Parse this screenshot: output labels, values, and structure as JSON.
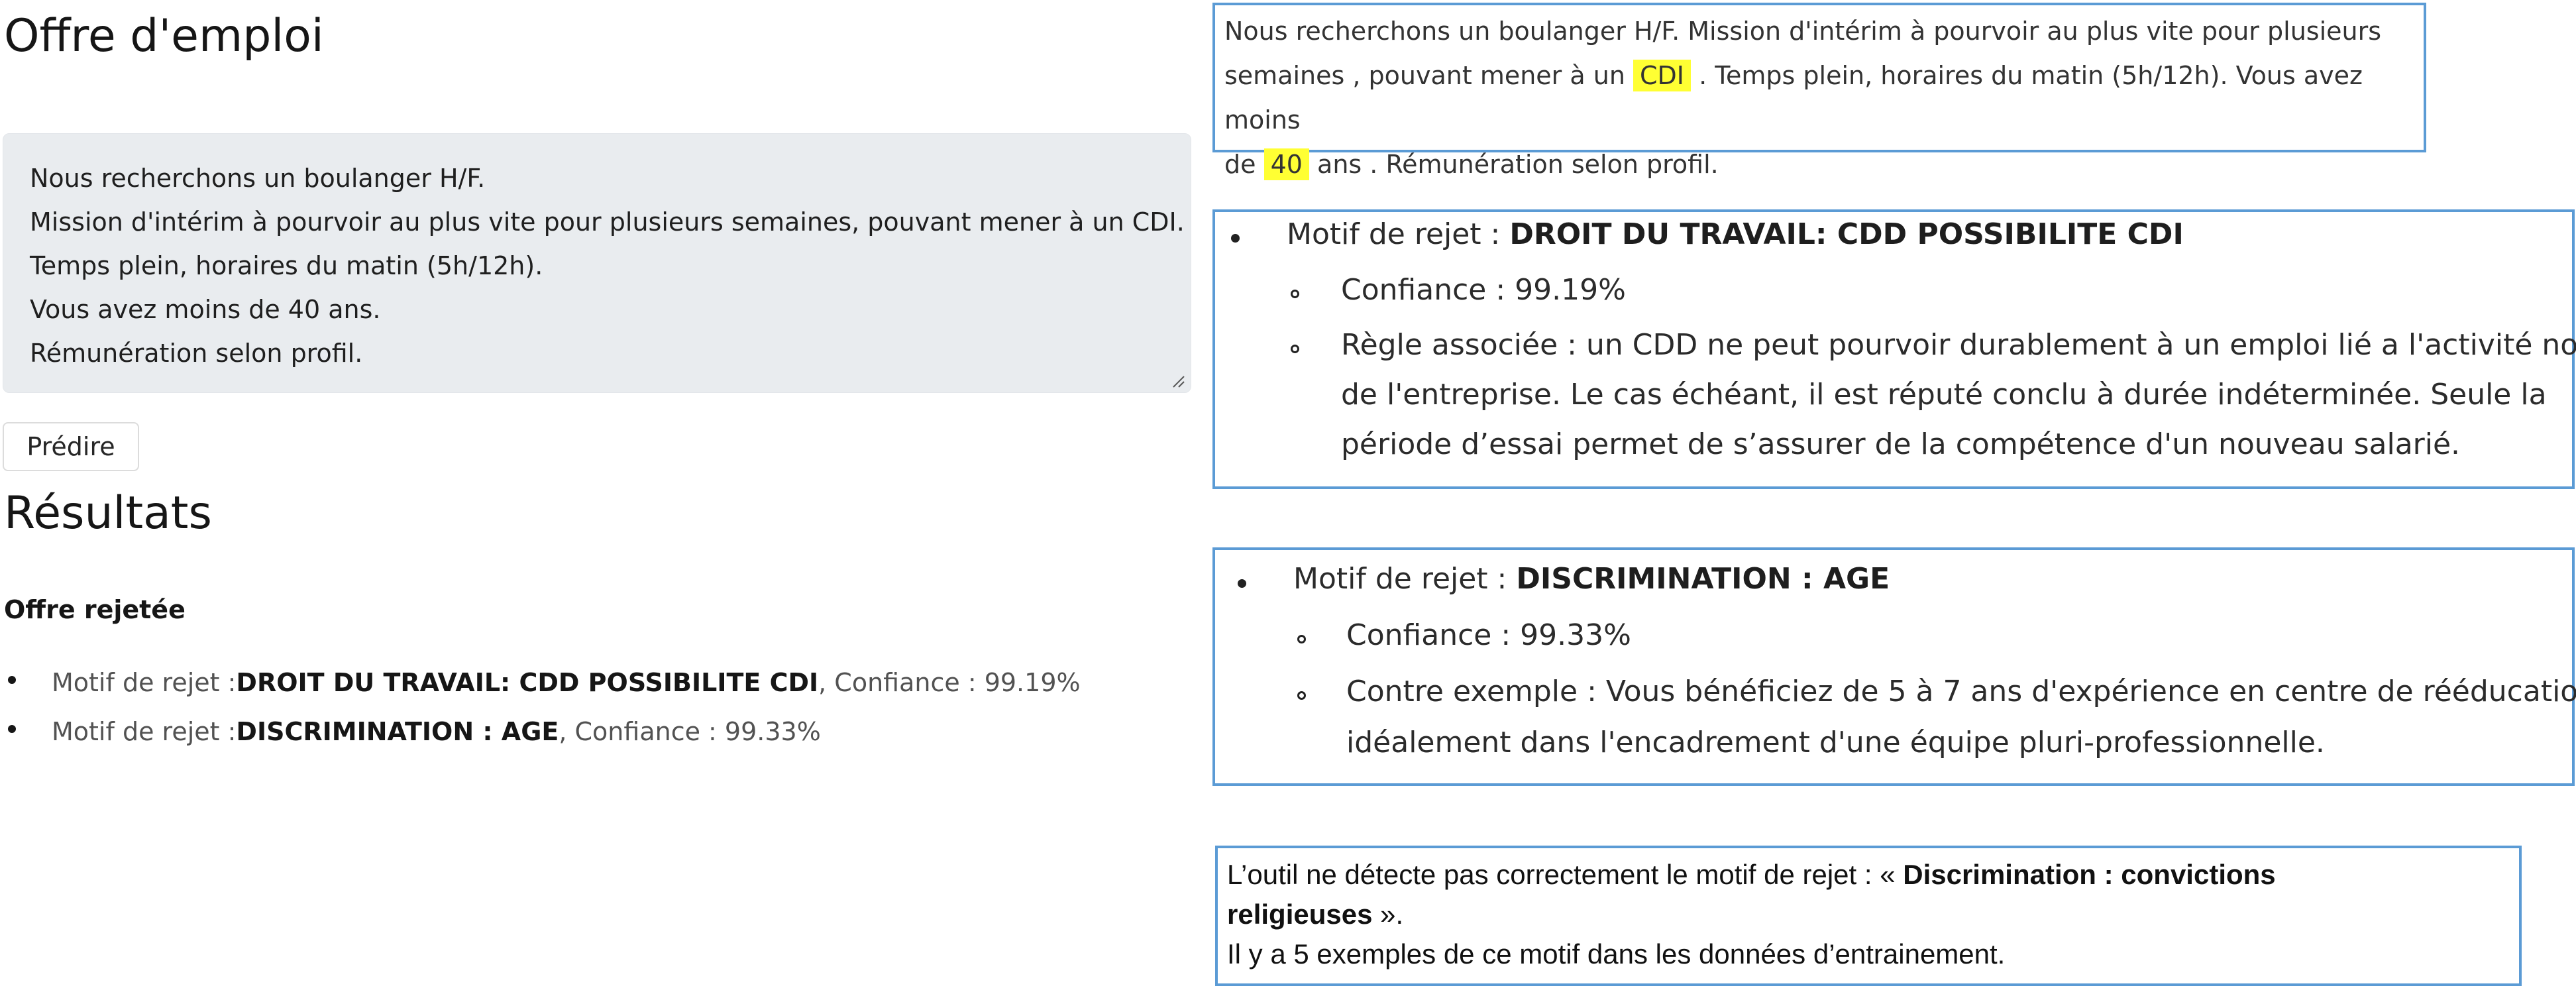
{
  "app": {
    "page_title": "Offre d'emploi",
    "textarea_lines": [
      "Nous recherchons un boulanger H/F.",
      "Mission d'intérim à pourvoir au plus vite pour plusieurs semaines, pouvant mener à un CDI.",
      "Temps plein, horaires du matin (5h/12h).",
      "Vous avez moins de 40 ans.",
      "Rémunération selon profil."
    ],
    "predict_button": "Prédire",
    "results_heading": "Résultats",
    "status": "Offre rejetée",
    "results": [
      {
        "prefix": "Motif de rejet : ",
        "reason": "DROIT DU TRAVAIL: CDD POSSIBILITE CDI",
        "confidence": ", Confiance : 99.19%"
      },
      {
        "prefix": "Motif de rejet : ",
        "reason": "DISCRIMINATION : AGE",
        "confidence": ", Confiance : 99.33%"
      }
    ]
  },
  "highlight": {
    "line1": "Nous recherchons un boulanger H/F. Mission d'intérim à pourvoir au plus vite pour plusieurs",
    "line2_a": "semaines , pouvant mener à un ",
    "line2_hl": "CDI",
    "line2_b": " . Temps plein, horaires du matin (5h/12h). Vous avez moins",
    "line3_a": "de ",
    "line3_hl": "40",
    "line3_b": " ans . Rémunération selon profil.",
    "highlight_color": "#ffff33"
  },
  "reason_box_1": {
    "motif_prefix": "Motif de rejet : ",
    "motif": "DROIT DU TRAVAIL: CDD POSSIBILITE CDI",
    "confidence": "Confiance : 99.19%",
    "rule_lines": [
      "Règle associée : un CDD ne peut pourvoir durablement à un emploi lié a l'activité normale",
      "de l'entreprise. Le cas échéant, il est réputé conclu à durée indéterminée. Seule la",
      "période d’essai permet de s’assurer de la compétence d'un nouveau salarié."
    ]
  },
  "reason_box_2": {
    "motif_prefix": "Motif de rejet : ",
    "motif": "DISCRIMINATION : AGE",
    "confidence": "Confiance : 99.33%",
    "counter_lines": [
      "Contre exemple : Vous bénéficiez de 5 à 7 ans d'expérience en centre de rééducation, et",
      "idéalement dans l'encadrement d'une équipe pluri-professionnelle."
    ]
  },
  "note": {
    "line1_a": "L’outil ne détecte pas correctement le motif de rejet : « ",
    "line1_b": "Discrimination : convictions",
    "line2_a": "religieuses",
    "line2_b": " ».",
    "line3": " Il y a 5 exemples de ce motif dans les données d’entrainement."
  },
  "colors": {
    "frame": "#5b9bd5",
    "textarea_bg": "#e9ecef"
  }
}
